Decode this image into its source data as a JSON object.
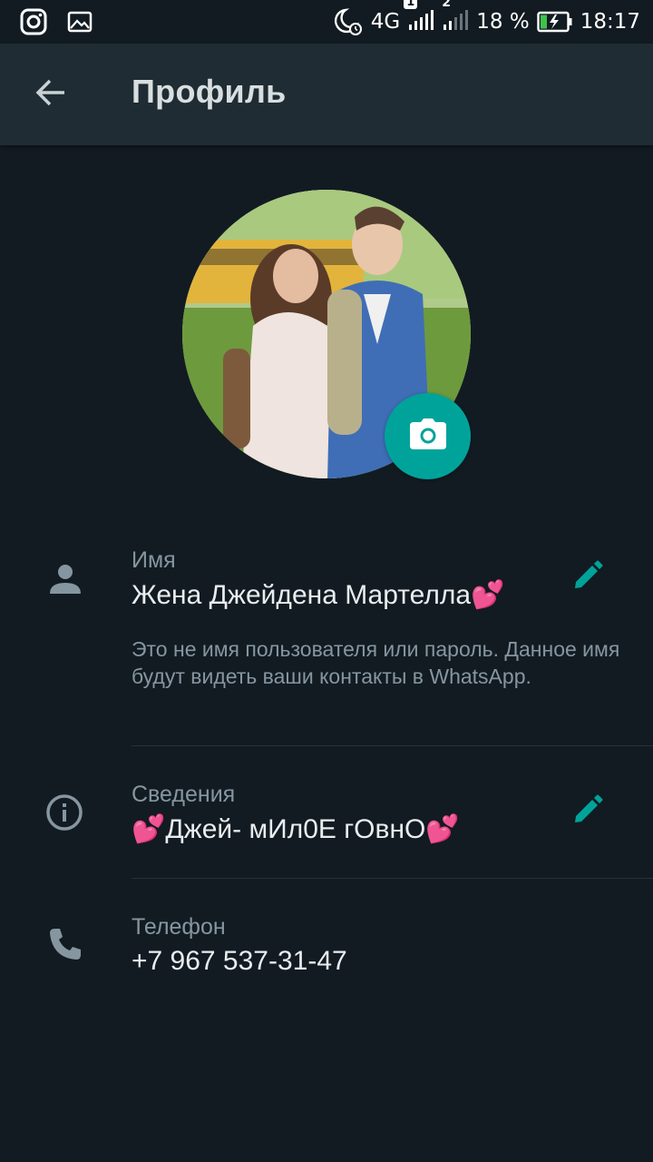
{
  "status_bar": {
    "network": "4G",
    "sim1_badge": "1",
    "sim2_label": "2",
    "battery": "18 %",
    "time": "18:17",
    "icons": [
      "instagram-icon",
      "gallery-icon",
      "do-not-disturb-alarm-icon",
      "signal-icon",
      "battery-charging-icon"
    ]
  },
  "header": {
    "title": "Профиль",
    "back_icon": "arrow-left-icon"
  },
  "profile": {
    "photo_description_icon": "profile-photo",
    "camera_icon": "camera-icon"
  },
  "name_section": {
    "label": "Имя",
    "value": "Жена Джейдена Мартелла💕",
    "hint": "Это не имя пользователя или пароль. Данное имя будут видеть ваши контакты в WhatsApp.",
    "icon": "person-icon",
    "edit_icon": "pencil-icon"
  },
  "about_section": {
    "label": "Сведения",
    "value": "💕Джей- мИл0Е гОвнО💕",
    "icon": "info-icon",
    "edit_icon": "pencil-icon"
  },
  "phone_section": {
    "label": "Телефон",
    "value": "+7 967 537-31-47",
    "icon": "phone-icon"
  },
  "colors": {
    "background": "#121b22",
    "appbar": "#1f2c34",
    "accent": "#00a39a",
    "secondary_text": "#8696a0",
    "primary_text": "#e9edef"
  }
}
